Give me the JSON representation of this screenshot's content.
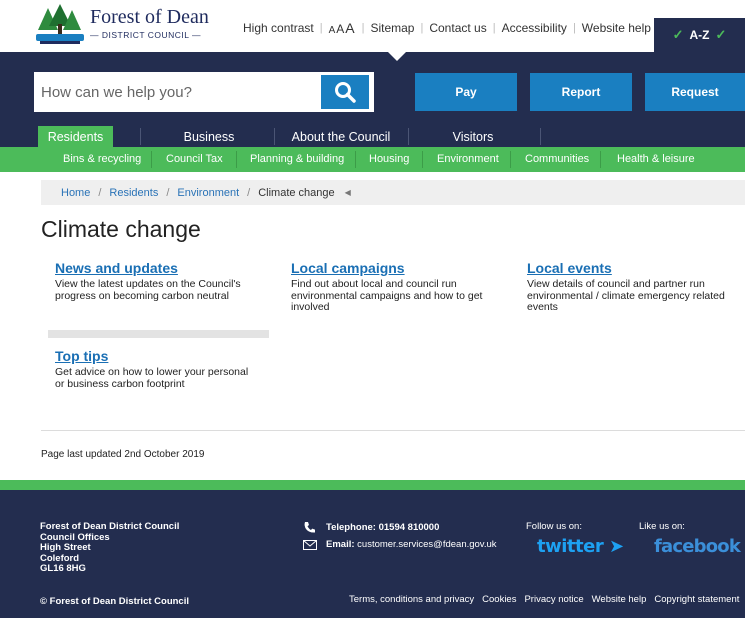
{
  "logo": {
    "title": "Forest of Dean",
    "subtitle": "— DISTRICT COUNCIL —"
  },
  "utility": {
    "high_contrast": "High contrast",
    "font_sizes": [
      "A",
      "A",
      "A"
    ],
    "sitemap": "Sitemap",
    "contact": "Contact us",
    "accessibility": "Accessibility",
    "help": "Website help",
    "az": "A-Z"
  },
  "search": {
    "placeholder": "How can we help you?"
  },
  "actions": [
    "Pay",
    "Report",
    "Request"
  ],
  "main_nav": [
    "Residents",
    "Business",
    "About the Council",
    "Visitors"
  ],
  "sub_nav": [
    "Bins & recycling",
    "Council Tax",
    "Planning & building",
    "Housing",
    "Environment",
    "Communities",
    "Health & leisure"
  ],
  "breadcrumb": [
    "Home",
    "Residents",
    "Environment",
    "Climate change"
  ],
  "page_title": "Climate change",
  "cards": [
    {
      "title": "News and updates",
      "desc": "View the latest updates on the Council's progress on becoming carbon neutral"
    },
    {
      "title": "Local campaigns",
      "desc": "Find out about local and council run environmental campaigns and how to get involved"
    },
    {
      "title": "Local events",
      "desc": "View details of council and partner run environmental / climate emergency related events"
    },
    {
      "title": "Top tips",
      "desc": "Get advice on how to lower your personal or business carbon footprint"
    }
  ],
  "last_updated": "Page last updated 2nd October 2019",
  "footer": {
    "address": [
      "Forest of Dean District Council",
      "Council Offices",
      "High Street",
      "Coleford",
      "GL16 8HG"
    ],
    "copyright": "© Forest of Dean District Council",
    "phone_label": "Telephone:",
    "phone": "01594 810000",
    "email_label": "Email:",
    "email": "customer.services@fdean.gov.uk",
    "follow": "Follow us on:",
    "like": "Like us on:",
    "twitter": "twitter",
    "facebook": "facebook",
    "links": [
      "Terms, conditions and privacy",
      "Cookies",
      "Privacy notice",
      "Website help",
      "Copyright statement"
    ]
  },
  "colors": {
    "navy": "#232d4f",
    "green": "#4cbb5a",
    "blue": "#1a7fc1",
    "link": "#1a6fb4"
  }
}
